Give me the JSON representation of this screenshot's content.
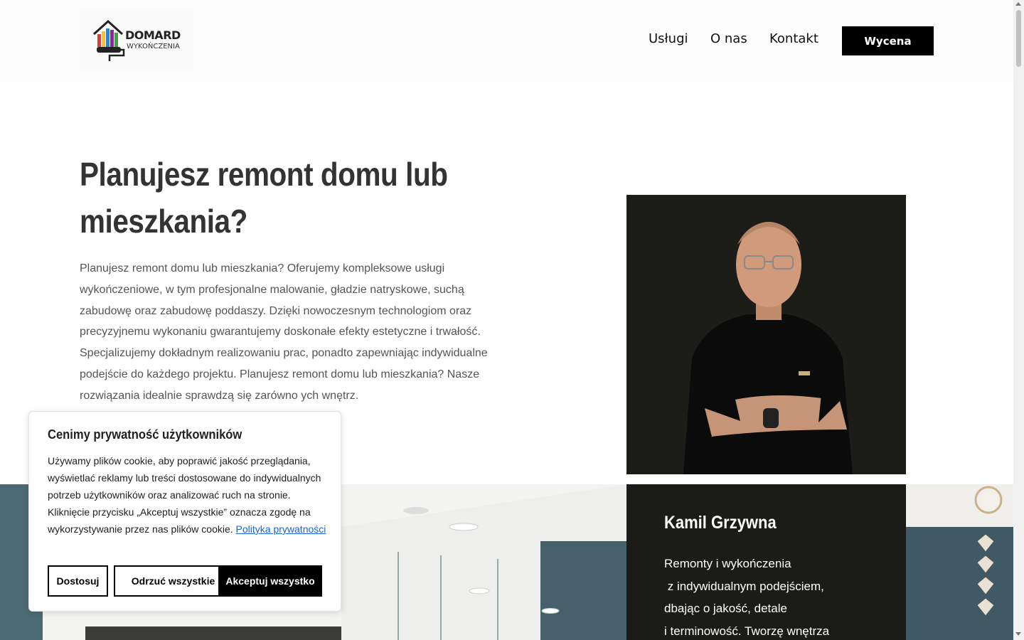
{
  "header": {
    "logo": {
      "line1": "DOMARD",
      "line2": "WYKOŃCZENIA"
    },
    "nav": [
      {
        "label": "Usługi"
      },
      {
        "label": "O nas"
      },
      {
        "label": "Kontakt"
      }
    ],
    "cta_label": "Wycena"
  },
  "hero": {
    "title": "Planujesz remont domu lub mieszkania?",
    "body": "Planujesz remont domu lub mieszkania? Oferujemy kompleksowe usługi wykończeniowe, w tym profesjonalne malowanie, gładzie natryskowe, suchą zabudowę oraz zabudowę poddaszy. Dzięki nowoczesnym technologiom oraz precyzyjnemu wykonaniu gwarantujemy doskonałe efekty estetyczne i trwałość. Specjalizujemy dokładnym realizowaniu prac, ponadto zapewniając indywidualne podejście do każdego projektu. Planujesz remont domu lub mieszkania? Nasze rozwiązania idealnie sprawdzą się zarówno",
    "body_tail": "ych wnętrz."
  },
  "profile": {
    "name": "Kamil Grzywna",
    "lines": [
      "Remonty i wykończenia",
      " z indywidualnym podejściem,",
      "dbając o jakość, detale",
      "i terminowość. Tworzę wnętrza"
    ]
  },
  "cookie": {
    "title": "Cenimy prywatność użytkowników",
    "text": "Używamy plików cookie, aby poprawić jakość przeglądania, wyświetlać reklamy lub treści dostosowane do indywidualnych potrzeb użytkowników oraz analizować ruch na stronie. Kliknięcie przycisku „Akceptuj wszystkie” oznacza zgodę na wykorzystywanie przez nas plików cookie.",
    "link": "Polityka prywatności",
    "buttons": {
      "customize": "Dostosuj",
      "reject": "Odrzuć wszystkie",
      "accept": "Akceptuj wszystko"
    }
  },
  "colors": {
    "cta_bg": "#000000",
    "card_bg": "#1b1b17",
    "link": "#1863dc"
  }
}
